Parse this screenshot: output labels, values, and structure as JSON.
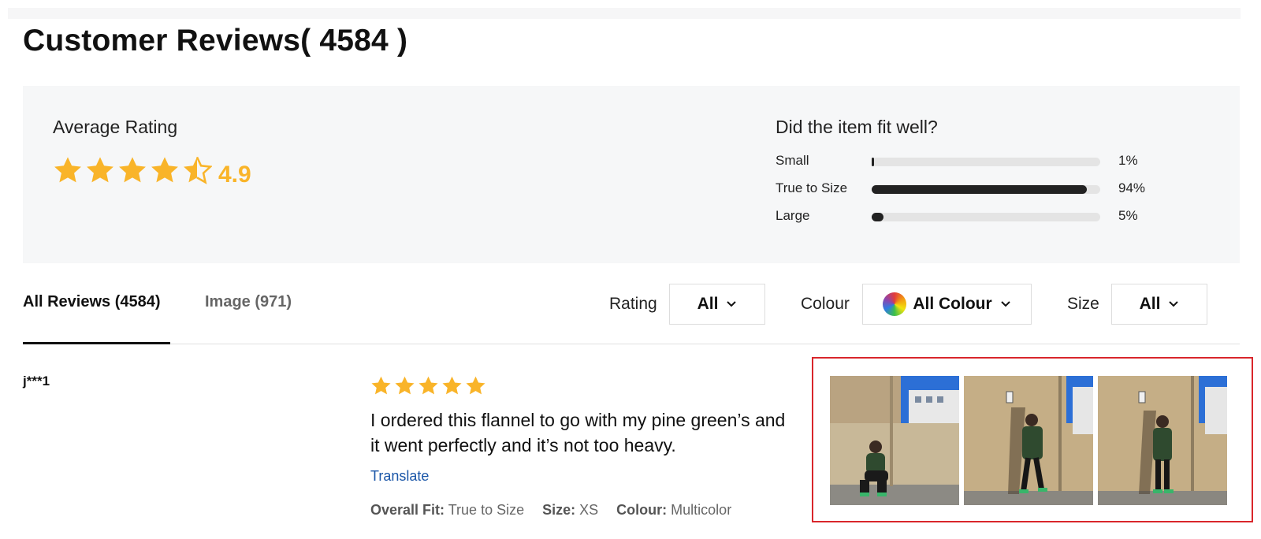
{
  "header": {
    "title": "Customer Reviews( 4584 )"
  },
  "summary": {
    "avg_label": "Average Rating",
    "avg_value": "4.9",
    "star_color": "#f9b429",
    "fit_title": "Did the item fit well?",
    "fit": [
      {
        "label": "Small",
        "percent_text": "1%",
        "fill": 0.01
      },
      {
        "label": "True to Size",
        "percent_text": "94%",
        "fill": 0.94
      },
      {
        "label": "Large",
        "percent_text": "5%",
        "fill": 0.05
      }
    ]
  },
  "tabs": [
    {
      "label": "All Reviews (4584)",
      "active": true
    },
    {
      "label": "Image (971)",
      "active": false
    }
  ],
  "filters": {
    "rating": {
      "label": "Rating",
      "value": "All"
    },
    "colour": {
      "label": "Colour",
      "value": "All Colour"
    },
    "size": {
      "label": "Size",
      "value": "All"
    }
  },
  "review": {
    "user": "j***1",
    "stars": 5,
    "text": "I ordered this flannel to go with my pine green’s and it went perfectly and it’s not too heavy.",
    "translate": "Translate",
    "fit_key": "Overall Fit:",
    "fit_val": "True to Size",
    "size_key": "Size:",
    "size_val": "XS",
    "colour_key": "Colour:",
    "colour_val": "Multicolor",
    "highlight_color": "#d9262b"
  }
}
